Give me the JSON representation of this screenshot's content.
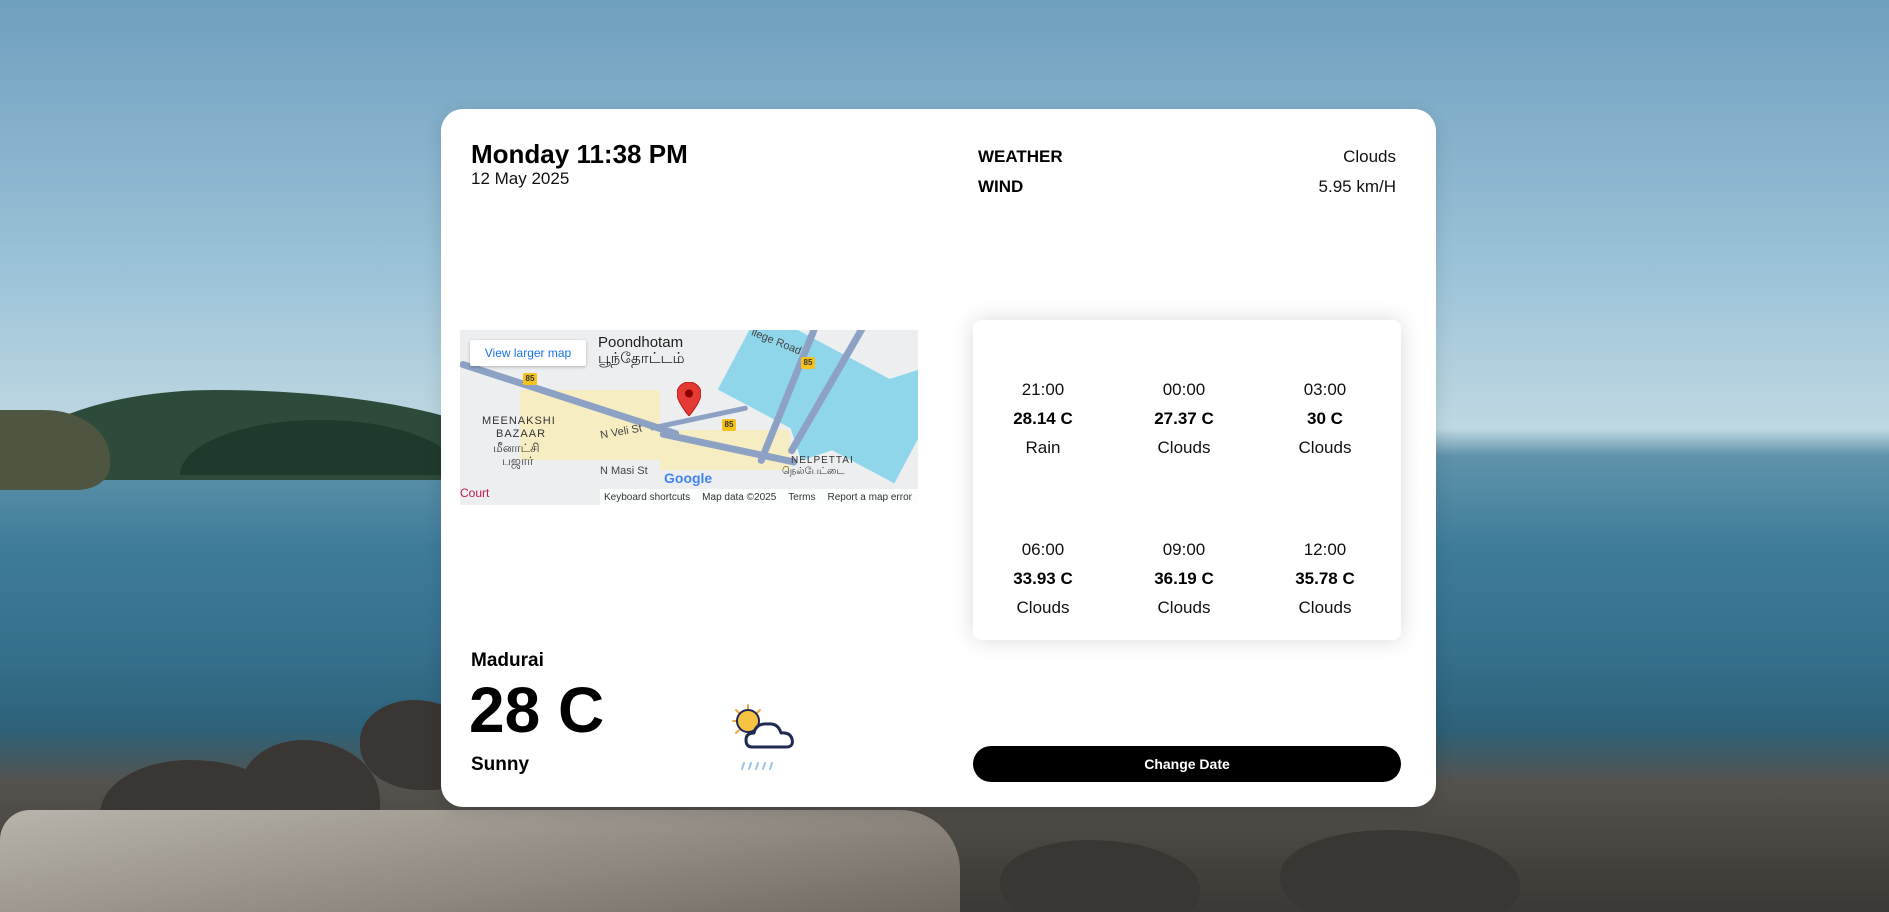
{
  "header": {
    "day_time": "Monday 11:38 PM",
    "date": "12 May 2025"
  },
  "info": [
    {
      "label": "WEATHER",
      "value": "Clouds"
    },
    {
      "label": "WIND",
      "value": "5.95 km/H"
    }
  ],
  "map": {
    "view_larger_label": "View larger map",
    "places": {
      "poondhotam": "Poondhotam",
      "poondhotam_ta": "பூந்தோட்டம்",
      "meenakshi": "MEENAKSHI",
      "bazaar": "BAZAAR",
      "meenakshi_ta": "மீனாட்சி",
      "bazaar_ta": "பஜார்",
      "nelpettai": "NELPETTAI",
      "nelpettai_ta": "நெல்பேட்டை",
      "n_veli_st": "N Veli St",
      "n_masi_st": "N Masi St",
      "college_road": "llege Road",
      "court": "Court"
    },
    "route_number": "85",
    "google_label": "Google",
    "footer": [
      "Keyboard shortcuts",
      "Map data ©2025",
      "Terms",
      "Report a map error"
    ]
  },
  "forecast": [
    {
      "time": "21:00",
      "temp": "28.14 C",
      "condition": "Rain"
    },
    {
      "time": "00:00",
      "temp": "27.37 C",
      "condition": "Clouds"
    },
    {
      "time": "03:00",
      "temp": "30 C",
      "condition": "Clouds"
    },
    {
      "time": "06:00",
      "temp": "33.93 C",
      "condition": "Clouds"
    },
    {
      "time": "09:00",
      "temp": "36.19 C",
      "condition": "Clouds"
    },
    {
      "time": "12:00",
      "temp": "35.78 C",
      "condition": "Clouds"
    }
  ],
  "current": {
    "city": "Madurai",
    "temperature": "28 C",
    "condition": "Sunny",
    "icon": "partly-cloudy-icon"
  },
  "actions": {
    "change_date_label": "Change Date"
  }
}
